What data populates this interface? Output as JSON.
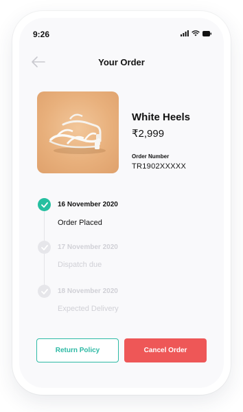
{
  "status_bar": {
    "time": "9:26"
  },
  "header": {
    "title": "Your Order"
  },
  "product": {
    "name": "White Heels",
    "price": "₹2,999",
    "order_number_label": "Order Number",
    "order_number": "TR1902XXXXX"
  },
  "timeline": [
    {
      "date": "16 November 2020",
      "status": "Order Placed",
      "state": "done"
    },
    {
      "date": "17 November 2020",
      "status": "Dispatch due",
      "state": "pending"
    },
    {
      "date": "18 November 2020",
      "status": "Expected Delivery",
      "state": "pending"
    }
  ],
  "actions": {
    "return_policy_label": "Return Policy",
    "cancel_order_label": "Cancel Order"
  },
  "colors": {
    "accent": "#25bfa0",
    "danger": "#ee5757",
    "background": "#f9f9fb"
  }
}
